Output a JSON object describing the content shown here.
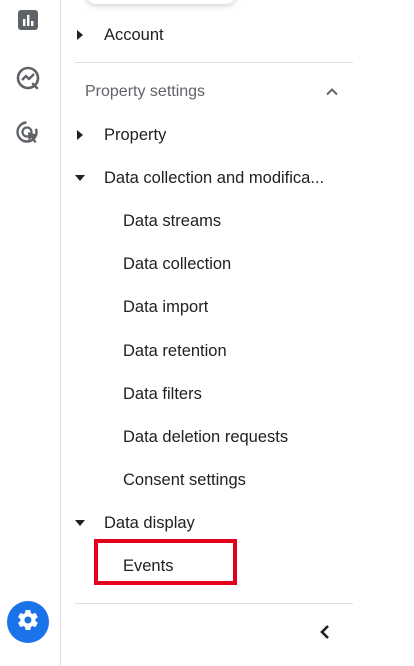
{
  "rail": {
    "items": [
      {
        "name": "reports-icon"
      },
      {
        "name": "explore-icon"
      },
      {
        "name": "advertising-icon"
      }
    ],
    "settings_icon": "gear-icon",
    "accent_color": "#1a73e8"
  },
  "nav": {
    "account": {
      "label": "Account",
      "expanded": false
    },
    "property_settings": {
      "label": "Property settings",
      "expanded": true
    },
    "property": {
      "label": "Property",
      "expanded": false
    },
    "data_collection": {
      "label": "Data collection and modifica...",
      "expanded": true,
      "items": [
        {
          "label": "Data streams"
        },
        {
          "label": "Data collection"
        },
        {
          "label": "Data import"
        },
        {
          "label": "Data retention"
        },
        {
          "label": "Data filters"
        },
        {
          "label": "Data deletion requests"
        },
        {
          "label": "Consent settings"
        }
      ]
    },
    "data_display": {
      "label": "Data display",
      "expanded": true,
      "items": [
        {
          "label": "Events"
        }
      ]
    }
  },
  "highlight_color": "#e3001b",
  "collapse_icon": "chevron-left-icon"
}
